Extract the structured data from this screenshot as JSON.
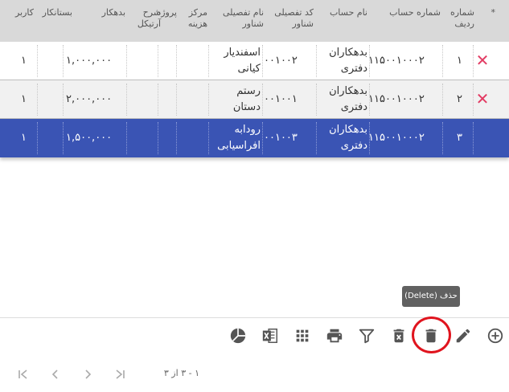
{
  "columns": {
    "star": "*",
    "row_no": "شماره ردیف",
    "account_no": "شماره حساب",
    "account_name": "نام حساب",
    "detail_code": "کد تفصیلی شناور",
    "detail_name": "نام تفصیلی شناور",
    "cost_center": "مرکز هزینه",
    "project": "پروژه",
    "article_desc": "شرح آرتیکل",
    "debit": "بدهکار",
    "credit": "بستانکار",
    "user": "کاربر"
  },
  "rows": [
    {
      "row_no": "۱",
      "account_no": "۱۱۵۰۰۱۰۰۰۲",
      "account_name": "بدهکاران دفتری",
      "detail_code": "۰۰۱۰۰۲",
      "detail_name": "اسفندیار کیانی",
      "debit": "۱,۰۰۰,۰۰۰",
      "user": "۱",
      "delete": "✕"
    },
    {
      "row_no": "۲",
      "account_no": "۱۱۵۰۰۱۰۰۰۲",
      "account_name": "بدهکاران دفتری",
      "detail_code": "۰۰۱۰۰۱",
      "detail_name": "رستم دستان",
      "debit": "۲,۰۰۰,۰۰۰",
      "user": "۱",
      "delete": "✕"
    },
    {
      "row_no": "۳",
      "account_no": "۱۱۵۰۰۱۰۰۰۲",
      "account_name": "بدهکاران دفتری",
      "detail_code": "۰۰۱۰۰۳",
      "detail_name": "رودابه افراسیابی",
      "debit": "۱,۵۰۰,۰۰۰",
      "user": "۱",
      "selected": true
    }
  ],
  "tooltip": "حذف (Delete)",
  "pager": {
    "info": "۱ - ۳ از ۳"
  },
  "colors": {
    "selected_row": "#3a54b4",
    "delete_x": "#e23b63",
    "highlight": "#e0141e"
  },
  "toolbar_icons": [
    "add-icon",
    "edit-icon",
    "delete-icon",
    "remove-icon",
    "filter-icon",
    "print-icon",
    "grid-icon",
    "excel-icon",
    "chart-icon"
  ]
}
